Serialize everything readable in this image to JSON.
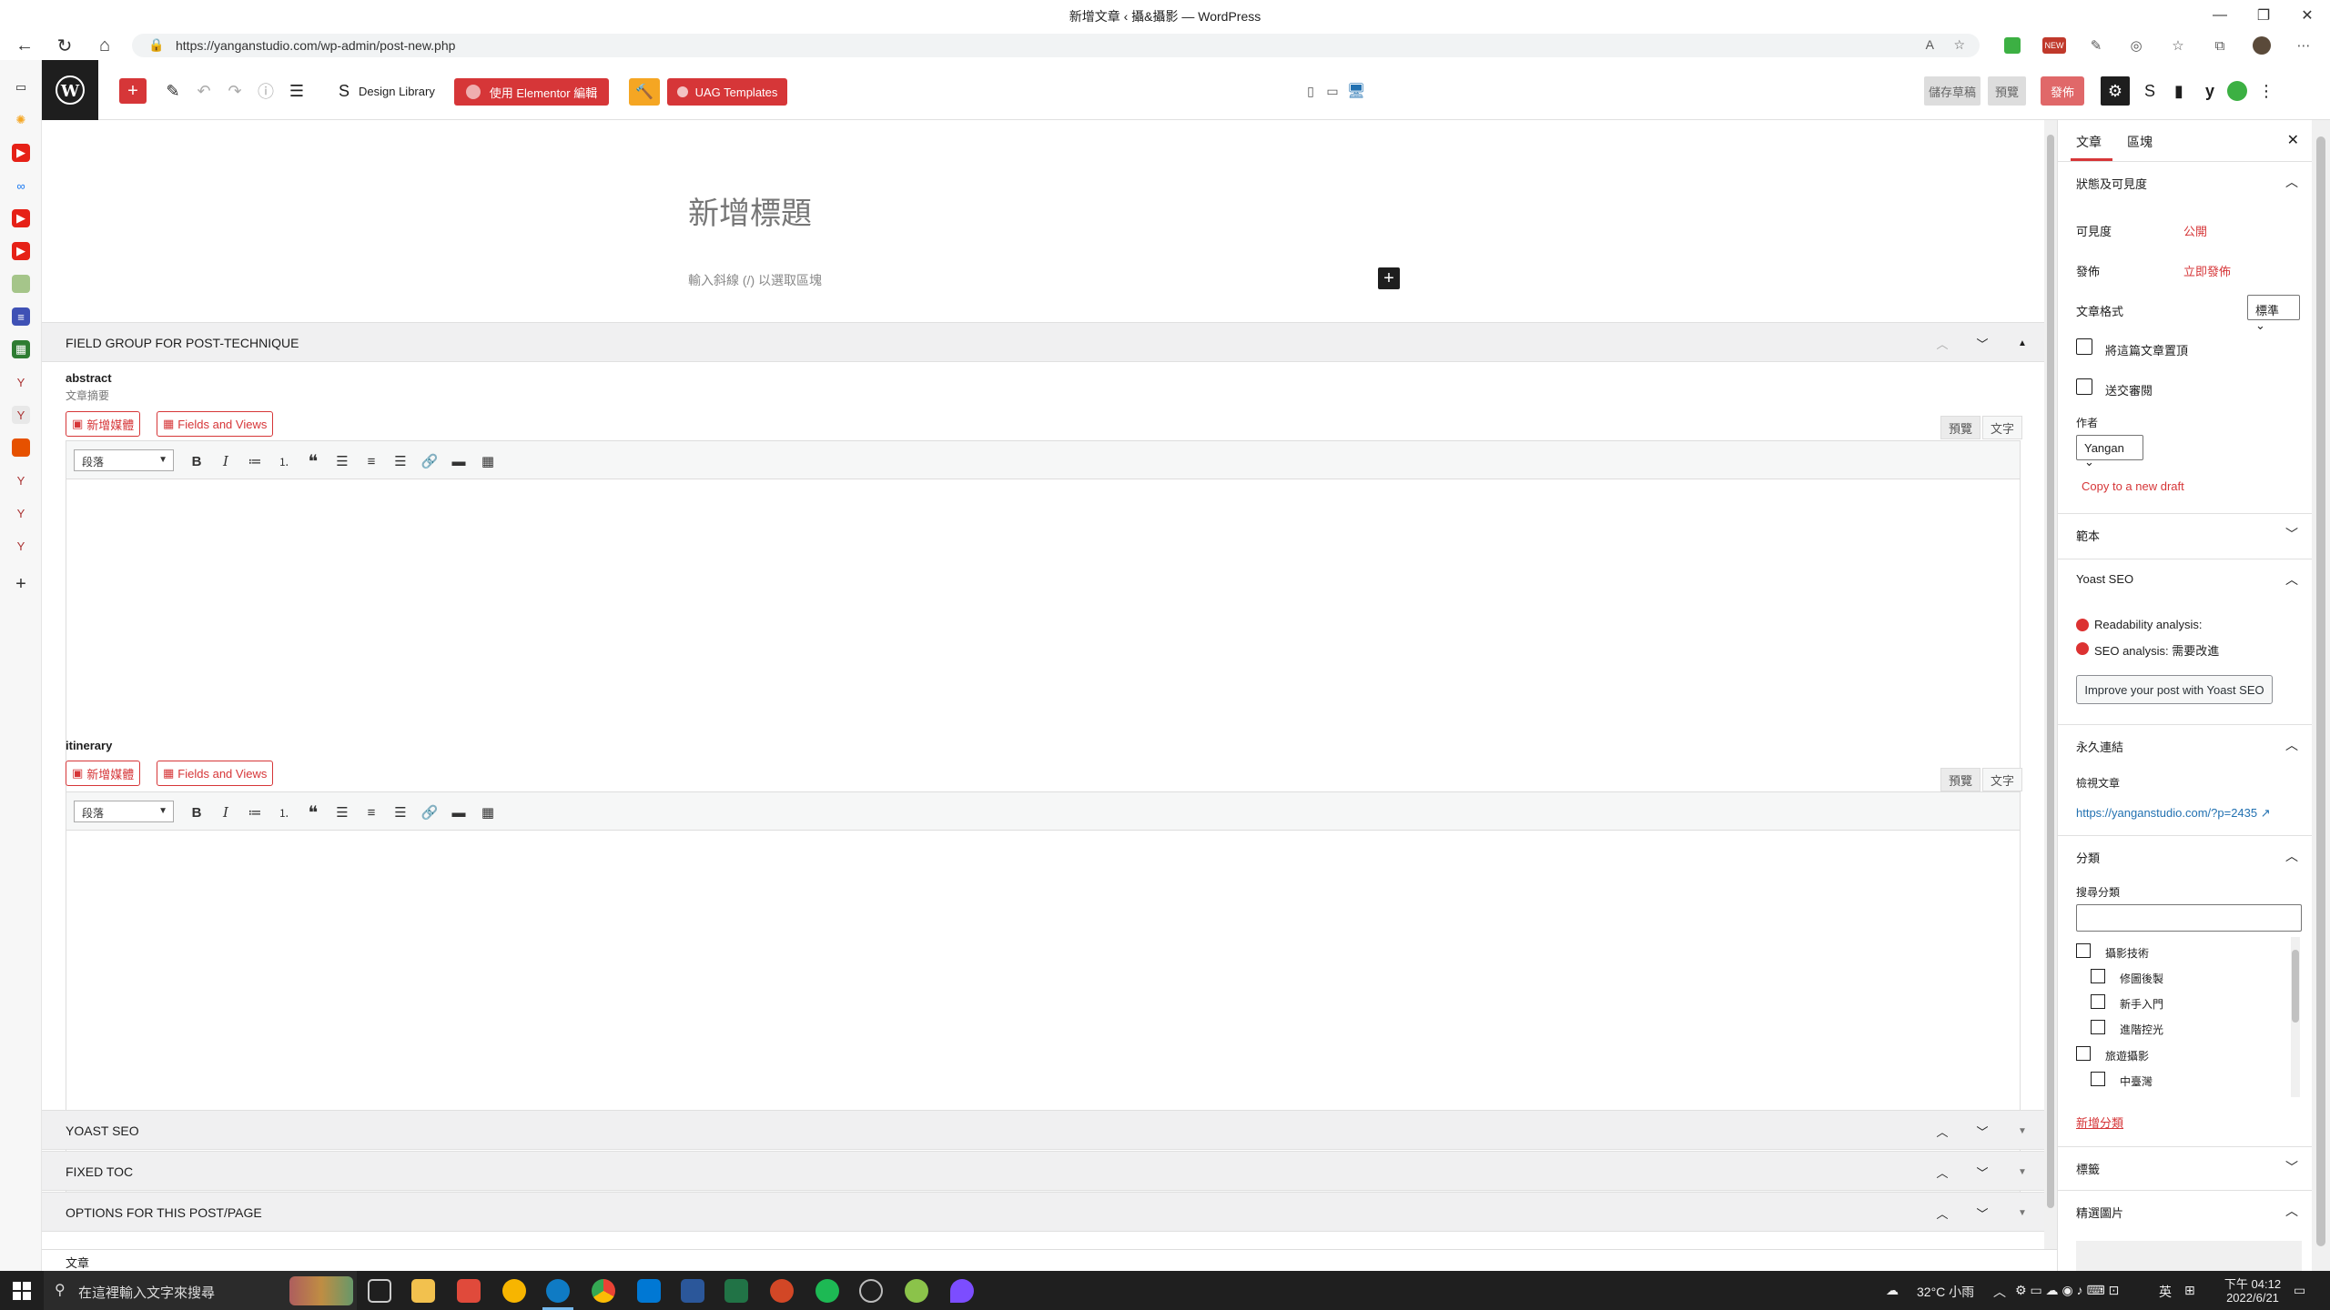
{
  "browser": {
    "window_title": "新增文章 ‹ 攝&攝影 — WordPress",
    "url": "https://yanganstudio.com/wp-admin/post-new.php"
  },
  "toolbar": {
    "design_library": "Design Library",
    "elementor": "使用 Elementor 編輯",
    "uag": "UAG Templates",
    "save_draft": "儲存草稿",
    "preview": "預覽",
    "publish": "發佈"
  },
  "editor": {
    "title_placeholder": "新增標題",
    "block_hint": "輸入斜線 (/) 以選取區塊"
  },
  "fieldgroup": {
    "title": "FIELD GROUP FOR POST-TECHNIQUE",
    "fields": [
      {
        "label": "abstract",
        "desc": "文章摘要"
      },
      {
        "label": "itinerary",
        "desc": ""
      }
    ],
    "add_media": "新增媒體",
    "fields_views": "Fields and Views",
    "tab_visual": "預覽",
    "tab_text": "文字",
    "format_select": "段落"
  },
  "metaboxes": [
    "YOAST SEO",
    "FIXED TOC",
    "OPTIONS FOR THIS POST/PAGE"
  ],
  "footer": {
    "breadcrumb": "文章"
  },
  "sidebar": {
    "tabs": [
      "文章",
      "區塊"
    ],
    "status_panel": "狀態及可見度",
    "visibility_label": "可見度",
    "visibility_value": "公開",
    "publish_label": "發佈",
    "publish_value": "立即發佈",
    "format_label": "文章格式",
    "format_value": "標準",
    "sticky": "將這篇文章置頂",
    "pending": "送交審閱",
    "author_label": "作者",
    "author_value": "Yangan",
    "copy_draft": "Copy to a new draft",
    "template_panel": "範本",
    "yoast_panel": "Yoast SEO",
    "readability": "Readability analysis:",
    "seo_analysis": "SEO analysis: 需要改進",
    "improve_btn": "Improve your post with Yoast SEO",
    "permalink_panel": "永久連結",
    "view_post": "檢視文章",
    "permalink_url": "https://yanganstudio.com/?p=2435",
    "category_panel": "分類",
    "search_category": "搜尋分類",
    "categories": [
      {
        "name": "攝影技術",
        "level": 0
      },
      {
        "name": "修圖後製",
        "level": 1
      },
      {
        "name": "新手入門",
        "level": 1
      },
      {
        "name": "進階控光",
        "level": 1
      },
      {
        "name": "旅遊攝影",
        "level": 0
      },
      {
        "name": "中臺灣",
        "level": 1
      }
    ],
    "add_category": "新增分類",
    "tags_panel": "標籤",
    "featured_panel": "精選圖片"
  },
  "taskbar": {
    "search_placeholder": "在這裡輸入文字來搜尋",
    "weather": "32°C 小雨",
    "ime": "英",
    "time": "下午 04:12",
    "date": "2022/6/21"
  }
}
